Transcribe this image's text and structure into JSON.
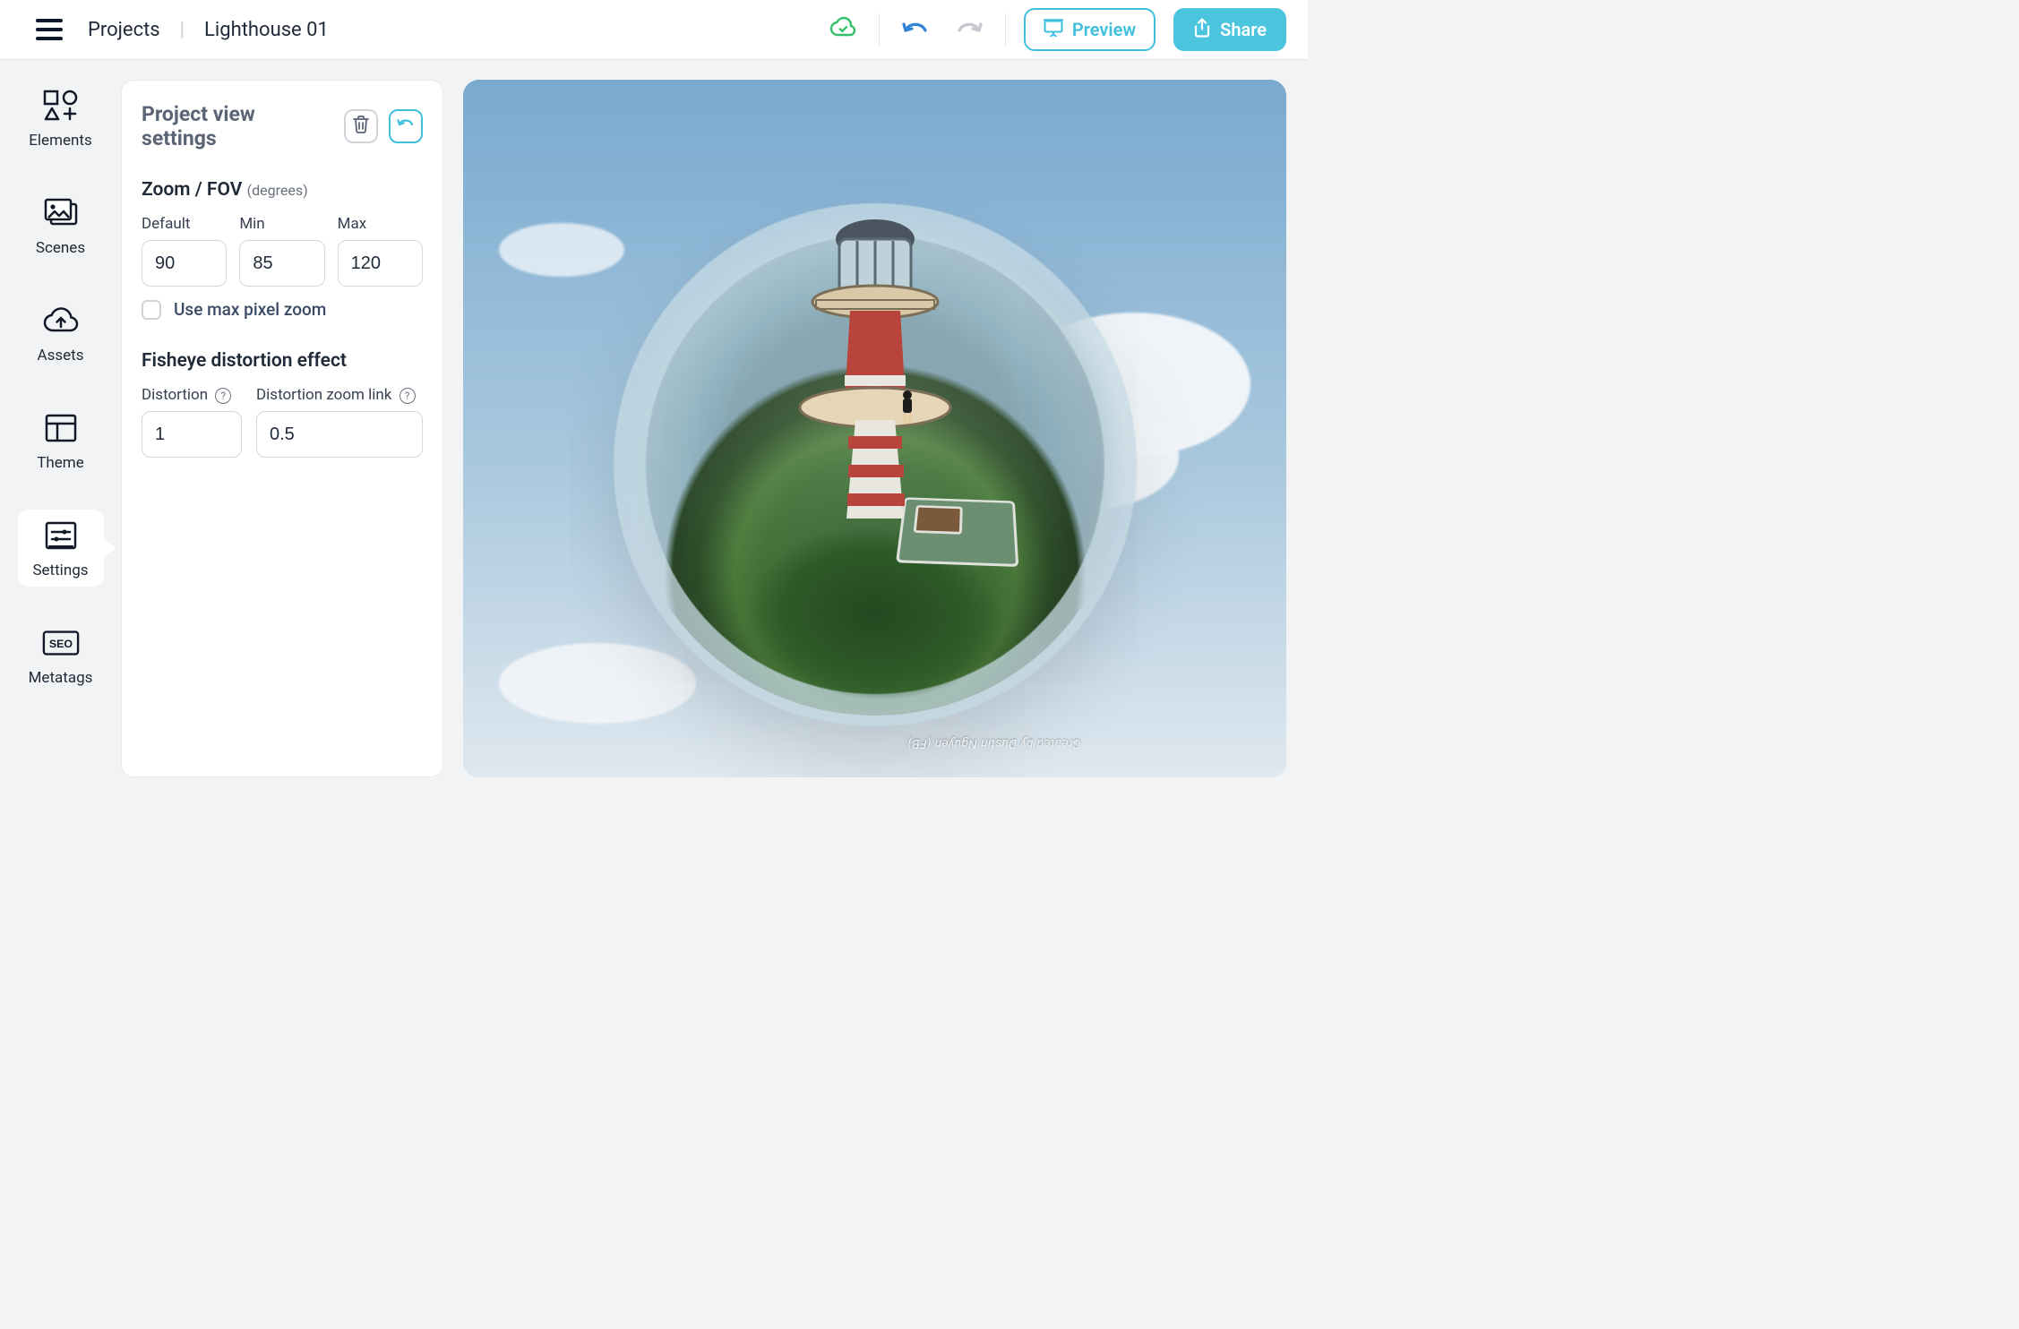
{
  "header": {
    "projects_label": "Projects",
    "project_name": "Lighthouse 01",
    "preview_label": "Preview",
    "share_label": "Share"
  },
  "rail": {
    "items": [
      {
        "key": "elements",
        "label": "Elements"
      },
      {
        "key": "scenes",
        "label": "Scenes"
      },
      {
        "key": "assets",
        "label": "Assets"
      },
      {
        "key": "theme",
        "label": "Theme"
      },
      {
        "key": "settings",
        "label": "Settings",
        "active": true
      },
      {
        "key": "metatags",
        "label": "Metatags"
      }
    ]
  },
  "panel": {
    "title": "Project view settings",
    "zoom_section": {
      "title": "Zoom / FOV",
      "hint": "(degrees)",
      "default_label": "Default",
      "min_label": "Min",
      "max_label": "Max",
      "default_value": "90",
      "min_value": "85",
      "max_value": "120",
      "use_max_pixel_zoom_label": "Use max pixel zoom",
      "use_max_pixel_zoom_checked": false
    },
    "fisheye_section": {
      "title": "Fisheye distortion effect",
      "distortion_label": "Distortion",
      "distortion_zoom_link_label": "Distortion zoom link",
      "distortion_value": "1",
      "distortion_zoom_link_value": "0.5"
    }
  },
  "canvas": {
    "credit_text": "Created by Dustin Nguyen (FB)"
  },
  "colors": {
    "accent": "#3ec0dd",
    "share": "#4bc5de",
    "sync_ok": "#34c06a"
  }
}
